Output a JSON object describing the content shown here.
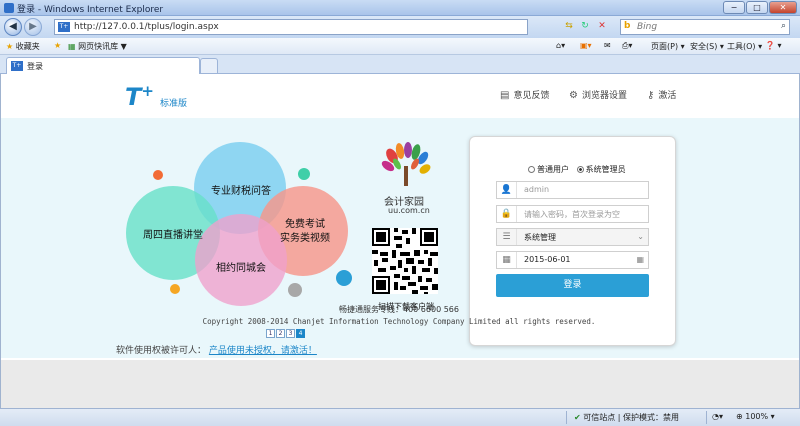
{
  "window": {
    "title": "登录 - Windows Internet Explorer",
    "controls": {
      "minimize": "−",
      "maximize": "□",
      "close": "✕"
    }
  },
  "address_bar": {
    "url": "http://127.0.0.1/tplus/login.aspx",
    "back_icon": "◀",
    "forward_icon": "▶",
    "search_placeholder": "Bing",
    "search_brand": "b"
  },
  "favorites_bar": {
    "favorites_label": "收藏夹",
    "quicklink_label": "网页快讯库 ▼"
  },
  "command_bar": {
    "page_label": "页面(P) ▾",
    "safety_label": "安全(S) ▾",
    "tools_label": "工具(O) ▾",
    "help_label": "❓ ▾"
  },
  "tab": {
    "label": "登录"
  },
  "header": {
    "logo_text": "T",
    "logo_sup": "+",
    "edition": "标准版",
    "nav": [
      {
        "label": "意见反馈",
        "icon": "feedback-icon"
      },
      {
        "label": "浏览器设置",
        "icon": "gear-icon"
      },
      {
        "label": "激活",
        "icon": "key-icon"
      }
    ]
  },
  "banner": {
    "circles": [
      "专业财税问答",
      "周四直播讲堂",
      "免费考试\n实务类视频",
      "相约同城会"
    ],
    "brand_name": "会计家园",
    "brand_domain": "uu.com.cn",
    "qr_caption": "扫描下载客户端",
    "pager": [
      "1",
      "2",
      "3",
      "4"
    ],
    "pager_active": 3,
    "colors": {
      "blue": "#7fd0f0",
      "green": "#66e0c8",
      "pink": "#f0a0cc",
      "salmon": "#f7968a"
    }
  },
  "license": {
    "prefix": "软件使用权被许可人：",
    "link": "产品使用未授权，请激活！"
  },
  "login": {
    "roles": [
      "普通用户",
      "系统管理员"
    ],
    "selected_role": 1,
    "username_value": "admin",
    "password_placeholder": "请输入密码，首次登录为空",
    "account_value": "系统管理",
    "date_value": "2015-06-01",
    "submit_label": "登录"
  },
  "footer": {
    "hotline": "畅捷通服务专线：400 6600 566",
    "copyright": "Copyright 2008-2014 Chanjet Information Technology Company Limited all rights reserved."
  },
  "status_bar": {
    "zone": "可信站点 | 保护模式：禁用",
    "zoom": "100%"
  }
}
